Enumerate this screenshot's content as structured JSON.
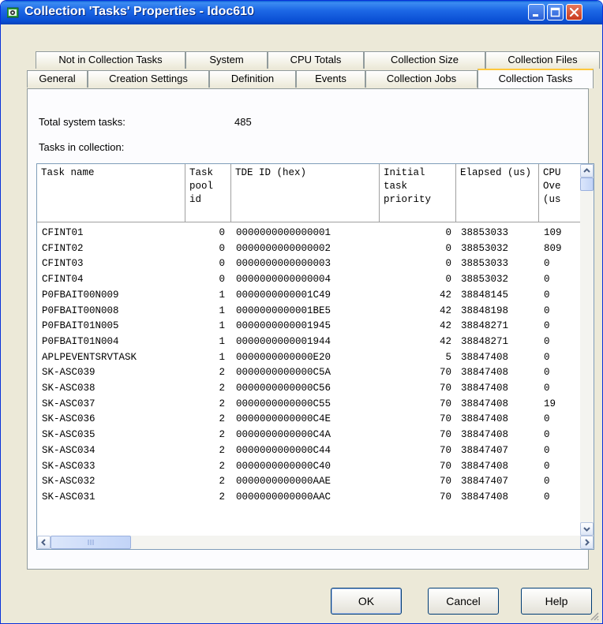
{
  "window": {
    "title": "Collection 'Tasks' Properties - Idoc610"
  },
  "tabs": {
    "row1": [
      "Not in Collection Tasks",
      "System",
      "CPU Totals",
      "Collection Size",
      "Collection Files"
    ],
    "row2": [
      "General",
      "Creation Settings",
      "Definition",
      "Events",
      "Collection Jobs",
      "Collection Tasks"
    ],
    "active": "Collection Tasks"
  },
  "panel": {
    "total_label": "Total system tasks:",
    "total_value": "485",
    "tasks_label": "Tasks in collection:"
  },
  "table": {
    "headers": [
      "Task name",
      "Task pool id",
      "TDE ID (hex)",
      "Initial task priority",
      "Elapsed (us)",
      "CPU Ove (us"
    ],
    "rows": [
      [
        "CFINT01",
        "0",
        "0000000000000001",
        "0",
        "38853033",
        "109"
      ],
      [
        "CFINT02",
        "0",
        "0000000000000002",
        "0",
        "38853032",
        "809"
      ],
      [
        "CFINT03",
        "0",
        "0000000000000003",
        "0",
        "38853033",
        "0"
      ],
      [
        "CFINT04",
        "0",
        "0000000000000004",
        "0",
        "38853032",
        "0"
      ],
      [
        "P0FBAIT00N009",
        "1",
        "0000000000001C49",
        "42",
        "38848145",
        "0"
      ],
      [
        "P0FBAIT00N008",
        "1",
        "0000000000001BE5",
        "42",
        "38848198",
        "0"
      ],
      [
        "P0FBAIT01N005",
        "1",
        "0000000000001945",
        "42",
        "38848271",
        "0"
      ],
      [
        "P0FBAIT01N004",
        "1",
        "0000000000001944",
        "42",
        "38848271",
        "0"
      ],
      [
        "APLPEVENTSRVTASK",
        "1",
        "0000000000000E20",
        "5",
        "38847408",
        "0"
      ],
      [
        "SK-ASC039",
        "2",
        "0000000000000C5A",
        "70",
        "38847408",
        "0"
      ],
      [
        "SK-ASC038",
        "2",
        "0000000000000C56",
        "70",
        "38847408",
        "0"
      ],
      [
        "SK-ASC037",
        "2",
        "0000000000000C55",
        "70",
        "38847408",
        "19"
      ],
      [
        "SK-ASC036",
        "2",
        "0000000000000C4E",
        "70",
        "38847408",
        "0"
      ],
      [
        "SK-ASC035",
        "2",
        "0000000000000C4A",
        "70",
        "38847408",
        "0"
      ],
      [
        "SK-ASC034",
        "2",
        "0000000000000C44",
        "70",
        "38847407",
        "0"
      ],
      [
        "SK-ASC033",
        "2",
        "0000000000000C40",
        "70",
        "38847408",
        "0"
      ],
      [
        "SK-ASC032",
        "2",
        "0000000000000AAE",
        "70",
        "38847407",
        "0"
      ],
      [
        "SK-ASC031",
        "2",
        "0000000000000AAC",
        "70",
        "38847408",
        "0"
      ]
    ]
  },
  "buttons": {
    "ok": "OK",
    "cancel": "Cancel",
    "help": "Help"
  },
  "colors": {
    "title_bar": "#0a4fd4",
    "dialog_bg": "#ece9d8",
    "active_tab_accent": "#ffc83c",
    "close_button": "#c9391d"
  }
}
